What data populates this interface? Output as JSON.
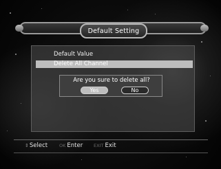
{
  "title": "Default Setting",
  "menu": {
    "items": [
      {
        "label": "Default Value"
      },
      {
        "label": "Delete All Channel"
      }
    ],
    "selected_index": 1
  },
  "dialog": {
    "message": "Are you sure to delete all?",
    "yes_label": "Yes",
    "no_label": "No",
    "focused": "Yes"
  },
  "footer": {
    "select": {
      "key": "⇕",
      "label": "Select"
    },
    "enter": {
      "key": "OK",
      "label": "Enter"
    },
    "exit": {
      "key": "EXIT",
      "label": "Exit"
    }
  },
  "colors": {
    "panel": "#464646",
    "highlight": "#bdbdbd",
    "text": "#ffffff"
  }
}
